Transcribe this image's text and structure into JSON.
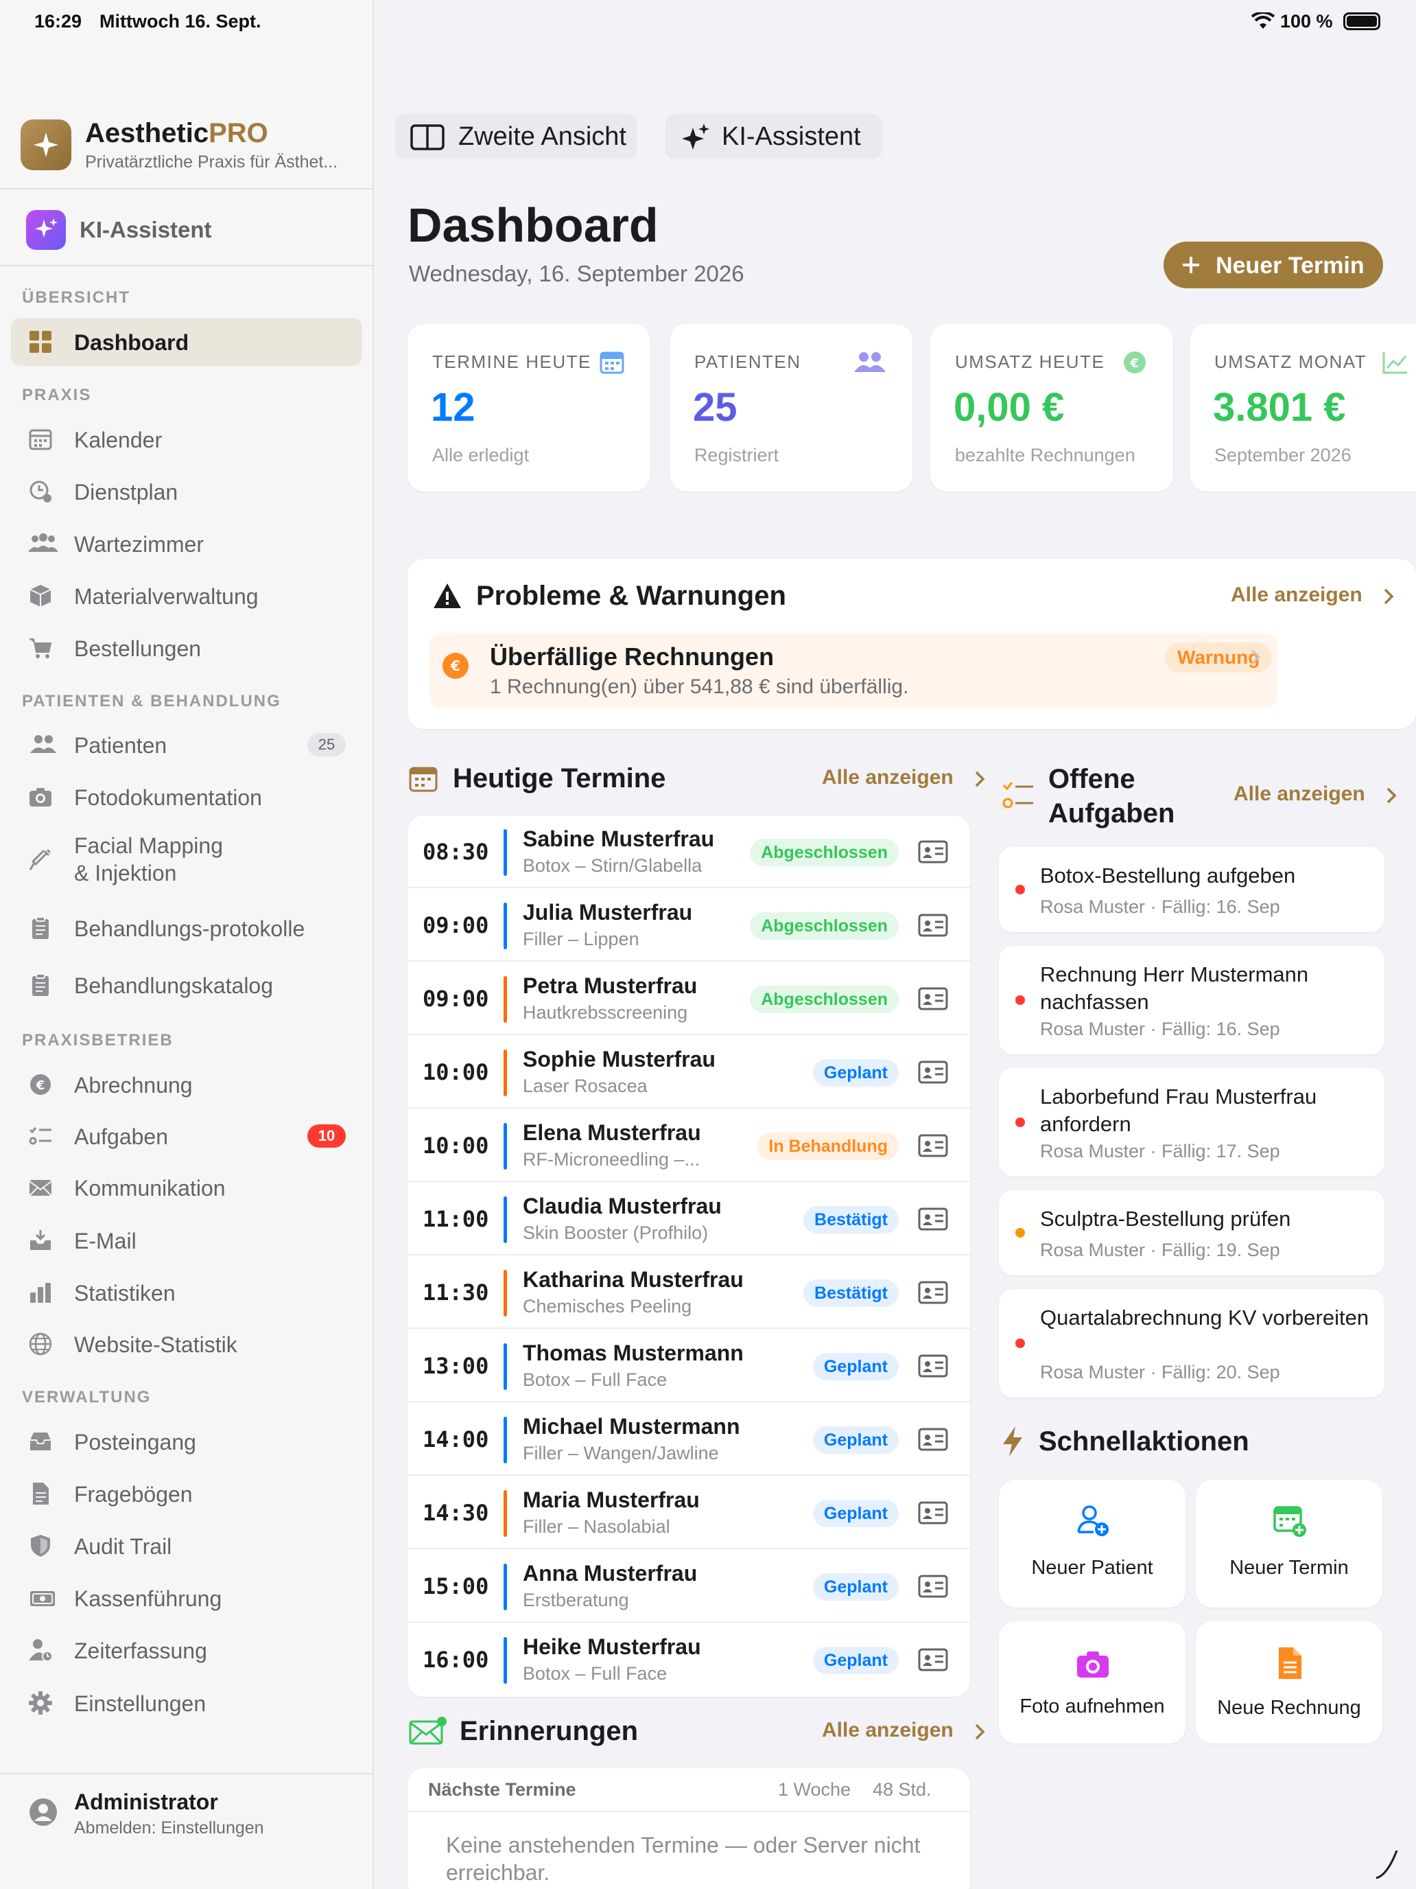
{
  "status_bar": {
    "time": "16:29",
    "date": "Mittwoch 16. Sept.",
    "battery": "100 %"
  },
  "app": {
    "name_dark": "Aesthetic",
    "name_accent": "PRO",
    "subtitle": "Privatärztliche Praxis für Ästhet...",
    "ai_label": "KI-Assistent"
  },
  "colors": {
    "accent": "#a07c3c",
    "blue": "#007aff",
    "purple": "#5e5ce6",
    "green": "#34c759",
    "orange": "#ff9500",
    "red": "#ff3b30"
  },
  "sidebar": {
    "sections": {
      "overview": "ÜBERSICHT",
      "practice": "PRAXIS",
      "patients": "PATIENTEN & BEHANDLUNG",
      "operations": "PRAXISBETRIEB",
      "admin": "VERWALTUNG"
    },
    "items": {
      "dashboard": "Dashboard",
      "kalender": "Kalender",
      "dienstplan": "Dienstplan",
      "wartezimmer": "Wartezimmer",
      "material": "Materialverwaltung",
      "bestellungen": "Bestellungen",
      "patienten": "Patienten",
      "patienten_badge": "25",
      "foto": "Fotodokumentation",
      "facial1": "Facial Mapping",
      "facial2": "& Injektion",
      "protokolle": "Behandlungs-protokolle",
      "katalog": "Behandlungskatalog",
      "abrechnung": "Abrechnung",
      "aufgaben": "Aufgaben",
      "aufgaben_badge": "10",
      "kommunikation": "Kommunikation",
      "email": "E-Mail",
      "statistiken": "Statistiken",
      "website": "Website-Statistik",
      "posteingang": "Posteingang",
      "frageboegen": "Fragebögen",
      "audit": "Audit Trail",
      "kasse": "Kassenführung",
      "zeit": "Zeiterfassung",
      "einstellungen": "Einstellungen"
    },
    "user": {
      "name": "Administrator",
      "sub": "Abmelden: Einstellungen"
    }
  },
  "toolbar": {
    "second_view": "Zweite Ansicht",
    "ai": "KI-Assistent"
  },
  "header": {
    "title": "Dashboard",
    "date": "Wednesday, 16. September 2026",
    "new_appointment": "Neuer Termin"
  },
  "stats": [
    {
      "label": "TERMINE HEUTE",
      "value": "12",
      "sub": "Alle erledigt",
      "color": "#007aff",
      "icon": "calendar-icon"
    },
    {
      "label": "PATIENTEN",
      "value": "25",
      "sub": "Registriert",
      "color": "#5e5ce6",
      "icon": "people-icon"
    },
    {
      "label": "UMSATZ HEUTE",
      "value": "0,00 €",
      "sub": "bezahlte Rechnungen",
      "color": "#34c759",
      "icon": "euro-icon"
    },
    {
      "label": "UMSATZ MONAT",
      "value": "3.801 €",
      "sub": "September 2026",
      "color": "#34c759",
      "icon": "chart-icon"
    }
  ],
  "warnings": {
    "title": "Probleme & Warnungen",
    "show_all": "Alle anzeigen",
    "item": {
      "title": "Überfällige Rechnungen",
      "desc": "1 Rechnung(en) über 541,88 € sind überfällig.",
      "badge": "Warnung"
    }
  },
  "appointments": {
    "title": "Heutige Termine",
    "show_all": "Alle anzeigen",
    "rows": [
      {
        "time": "08:30",
        "name": "Sabine Musterfrau",
        "treatment": "Botox – Stirn/Glabella",
        "status": "Abgeschlossen",
        "bar": "#007aff",
        "kind": "done"
      },
      {
        "time": "09:00",
        "name": "Julia Musterfrau",
        "treatment": "Filler – Lippen",
        "status": "Abgeschlossen",
        "bar": "#007aff",
        "kind": "done"
      },
      {
        "time": "09:00",
        "name": "Petra Musterfrau",
        "treatment": "Hautkrebsscreening",
        "status": "Abgeschlossen",
        "bar": "#ff6b00",
        "kind": "done"
      },
      {
        "time": "10:00",
        "name": "Sophie Musterfrau",
        "treatment": "Laser Rosacea",
        "status": "Geplant",
        "bar": "#ff6b00",
        "kind": "planned"
      },
      {
        "time": "10:00",
        "name": "Elena Musterfrau",
        "treatment": "RF-Microneedling –...",
        "status": "In Behandlung",
        "bar": "#007aff",
        "kind": "active"
      },
      {
        "time": "11:00",
        "name": "Claudia Musterfrau",
        "treatment": "Skin Booster (Profhilo)",
        "status": "Bestätigt",
        "bar": "#007aff",
        "kind": "planned"
      },
      {
        "time": "11:30",
        "name": "Katharina Musterfrau",
        "treatment": "Chemisches Peeling",
        "status": "Bestätigt",
        "bar": "#ff6b00",
        "kind": "planned"
      },
      {
        "time": "13:00",
        "name": "Thomas Mustermann",
        "treatment": "Botox – Full Face",
        "status": "Geplant",
        "bar": "#007aff",
        "kind": "planned"
      },
      {
        "time": "14:00",
        "name": "Michael Mustermann",
        "treatment": "Filler – Wangen/Jawline",
        "status": "Geplant",
        "bar": "#007aff",
        "kind": "planned"
      },
      {
        "time": "14:30",
        "name": "Maria Musterfrau",
        "treatment": "Filler – Nasolabial",
        "status": "Geplant",
        "bar": "#ff6b00",
        "kind": "planned"
      },
      {
        "time": "15:00",
        "name": "Anna Musterfrau",
        "treatment": "Erstberatung",
        "status": "Geplant",
        "bar": "#007aff",
        "kind": "planned"
      },
      {
        "time": "16:00",
        "name": "Heike Musterfrau",
        "treatment": "Botox – Full Face",
        "status": "Geplant",
        "bar": "#007aff",
        "kind": "planned"
      }
    ]
  },
  "tasks": {
    "title_line1": "Offene",
    "title_line2": "Aufgaben",
    "show_all": "Alle anzeigen",
    "items": [
      {
        "title": "Botox-Bestellung aufgeben",
        "meta": "Rosa Muster · Fällig: 16. Sep",
        "dot": "#ff3b30"
      },
      {
        "title": "Rechnung Herr Mustermann nachfassen",
        "meta": "Rosa Muster · Fällig: 16. Sep",
        "dot": "#ff3b30"
      },
      {
        "title": "Laborbefund Frau Musterfrau anfordern",
        "meta": "Rosa Muster · Fällig: 17. Sep",
        "dot": "#ff3b30"
      },
      {
        "title": "Sculptra-Bestellung prüfen",
        "meta": "Rosa Muster · Fällig: 19. Sep",
        "dot": "#ff9500"
      },
      {
        "title": "Quartalabrechnung KV vorbereiten",
        "meta": "Rosa Muster · Fällig: 20. Sep",
        "dot": "#ff3b30"
      }
    ]
  },
  "quick": {
    "title": "Schnellaktionen",
    "items": [
      {
        "label": "Neuer Patient",
        "icon": "add-person-icon"
      },
      {
        "label": "Neuer Termin",
        "icon": "calendar-add-icon"
      },
      {
        "label": "Foto aufnehmen",
        "icon": "camera-icon"
      },
      {
        "label": "Neue Rechnung",
        "icon": "document-icon"
      }
    ]
  },
  "reminders": {
    "title": "Erinnerungen",
    "show_all": "Alle anzeigen",
    "header_label": "Nächste Termine",
    "opt_week": "1 Woche",
    "opt_48": "48 Std.",
    "empty": "Keine anstehenden Termine — oder Server nicht erreichbar."
  }
}
